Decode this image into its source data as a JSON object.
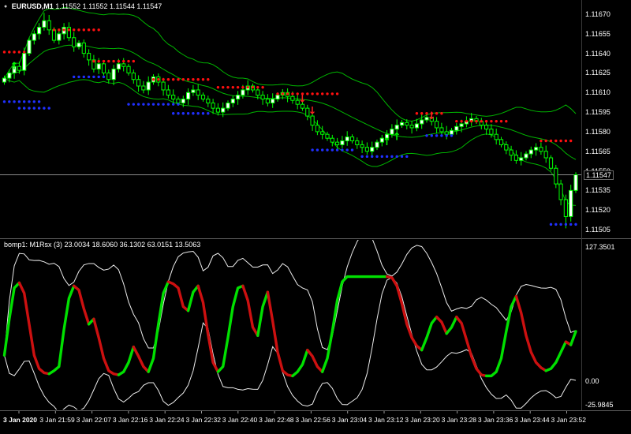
{
  "header": {
    "symbol": "EURUSD,M1",
    "ohlc": "1.11552 1.11552 1.11544 1.11547",
    "marker": "●"
  },
  "indicator_header": {
    "name": "bomp1: M1Rsx (3)",
    "values": "23.0034 18.6060 36.1302 63.0151 13.5063"
  },
  "price_axis": {
    "labels": [
      "1.11670",
      "1.11655",
      "1.11640",
      "1.11625",
      "1.11610",
      "1.11595",
      "1.11580",
      "1.11565",
      "1.11550",
      "1.11535",
      "1.11520",
      "1.11505"
    ],
    "current_price": "1.11547"
  },
  "indicator_axis": {
    "max": "127.3501",
    "zero": "0.00",
    "min": "-25.9845"
  },
  "time_axis": {
    "labels": [
      "3 Jan 2020",
      "3 Jan 21:59",
      "3 Jan 22:07",
      "3 Jan 22:16",
      "3 Jan 22:24",
      "3 Jan 22:32",
      "3 Jan 22:40",
      "3 Jan 22:48",
      "3 Jan 22:56",
      "3 Jan 23:04",
      "3 Jan 23:12",
      "3 Jan 23:20",
      "3 Jan 23:28",
      "3 Jan 23:36",
      "3 Jan 23:44",
      "3 Jan 23:52"
    ]
  },
  "colors": {
    "background": "#000000",
    "axis_text": "#ffffff",
    "separator": "#616161",
    "bid_line": "#8a8a8a",
    "candle_border": "#00ff00",
    "bull_fill": "#ffffff",
    "bear_fill": "#000000",
    "band": "#00b400",
    "sell_dot": "#ff1010",
    "buy_dot": "#2030ff",
    "arrow_up": "#00ff00",
    "arrow_down": "#ff2020",
    "osc_up": "#00e000",
    "osc_down": "#cc1010",
    "osc_band": "#ededed"
  },
  "chart_data": [
    {
      "type": "candlestick",
      "title": "EURUSD M1 price with Bollinger Bands and semafor dots",
      "ylim": [
        1.11495,
        1.1168
      ],
      "bid": 1.11547,
      "bollinger": {
        "period": 20,
        "deviation": 2
      },
      "closes": [
        1.11621,
        1.11625,
        1.1163,
        1.11627,
        1.1164,
        1.1165,
        1.11655,
        1.1166,
        1.11665,
        1.11658,
        1.1165,
        1.11655,
        1.1166,
        1.11652,
        1.11645,
        1.11648,
        1.1164,
        1.11635,
        1.11628,
        1.11632,
        1.11625,
        1.1162,
        1.11628,
        1.11632,
        1.1163,
        1.11625,
        1.1162,
        1.11615,
        1.11612,
        1.11618,
        1.11622,
        1.11618,
        1.11612,
        1.11608,
        1.11605,
        1.11602,
        1.11605,
        1.1161,
        1.11612,
        1.11608,
        1.11605,
        1.11602,
        1.11598,
        1.11595,
        1.11598,
        1.11602,
        1.11605,
        1.11608,
        1.11612,
        1.11615,
        1.11612,
        1.11608,
        1.11605,
        1.11602,
        1.11605,
        1.11608,
        1.1161,
        1.11607,
        1.11604,
        1.11601,
        1.11598,
        1.11592,
        1.11585,
        1.1158,
        1.11578,
        1.11575,
        1.11572,
        1.1157,
        1.11573,
        1.11576,
        1.11573,
        1.1157,
        1.11568,
        1.11565,
        1.11568,
        1.11572,
        1.11575,
        1.11578,
        1.11582,
        1.11585,
        1.11587,
        1.11585,
        1.11583,
        1.11586,
        1.11589,
        1.11591,
        1.11588,
        1.11583,
        1.1158,
        1.11578,
        1.11581,
        1.11584,
        1.11586,
        1.11588,
        1.1159,
        1.11588,
        1.11585,
        1.11582,
        1.11578,
        1.11574,
        1.1157,
        1.11566,
        1.11562,
        1.11558,
        1.1156,
        1.11563,
        1.11566,
        1.11568,
        1.11565,
        1.1156,
        1.11552,
        1.1154,
        1.11528,
        1.11515,
        1.11535,
        1.11547
      ],
      "wick_overrides": {
        "highs": {
          "8": 1.11671
        },
        "lows": {
          "113": 1.11506
        }
      },
      "sell_dots": [
        {
          "from": 0,
          "to": 4,
          "price": 1.11641
        },
        {
          "from": 10,
          "to": 19,
          "price": 1.11658
        },
        {
          "from": 18,
          "to": 26,
          "price": 1.11634
        },
        {
          "from": 30,
          "to": 41,
          "price": 1.1162
        },
        {
          "from": 43,
          "to": 52,
          "price": 1.11614
        },
        {
          "from": 55,
          "to": 67,
          "price": 1.11609
        },
        {
          "from": 83,
          "to": 88,
          "price": 1.11594
        },
        {
          "from": 91,
          "to": 101,
          "price": 1.11588
        },
        {
          "from": 108,
          "to": 114,
          "price": 1.11573
        }
      ],
      "buy_dots": [
        {
          "from": 0,
          "to": 7,
          "price": 1.11603
        },
        {
          "from": 3,
          "to": 9,
          "price": 1.11598
        },
        {
          "from": 14,
          "to": 20,
          "price": 1.11622
        },
        {
          "from": 25,
          "to": 35,
          "price": 1.11601
        },
        {
          "from": 34,
          "to": 41,
          "price": 1.11594
        },
        {
          "from": 62,
          "to": 70,
          "price": 1.11566
        },
        {
          "from": 72,
          "to": 81,
          "price": 1.11561
        },
        {
          "from": 85,
          "to": 90,
          "price": 1.11577
        },
        {
          "from": 110,
          "to": 115,
          "price": 1.11509
        }
      ],
      "arrows": [
        {
          "index": 2,
          "dir": "up",
          "price": 1.1163
        },
        {
          "index": 60,
          "dir": "down",
          "price": 1.11605
        },
        {
          "index": 62,
          "dir": "down",
          "price": 1.11596
        },
        {
          "index": 77,
          "dir": "up",
          "price": 1.11572
        },
        {
          "index": 79,
          "dir": "up",
          "price": 1.11576
        },
        {
          "index": 86,
          "dir": "down",
          "price": 1.11592
        }
      ]
    },
    {
      "type": "line",
      "title": "M1Rsx oscillator with volatility bands",
      "ylim": [
        -25.9845,
        127.3501
      ],
      "bands": {
        "period": 10,
        "deviation": 2
      },
      "values": [
        25,
        60,
        90,
        95,
        85,
        55,
        25,
        12,
        8,
        7,
        10,
        14,
        50,
        80,
        92,
        88,
        70,
        55,
        60,
        42,
        22,
        10,
        7,
        6,
        9,
        18,
        33,
        24,
        14,
        9,
        22,
        55,
        85,
        96,
        94,
        90,
        72,
        68,
        86,
        92,
        76,
        45,
        18,
        9,
        14,
        42,
        72,
        90,
        92,
        78,
        52,
        44,
        72,
        86,
        58,
        28,
        10,
        6,
        5,
        9,
        16,
        30,
        24,
        14,
        9,
        22,
        48,
        78,
        96,
        101,
        101,
        101,
        101,
        101,
        101,
        101,
        101,
        101,
        100,
        92,
        75,
        55,
        42,
        34,
        30,
        42,
        56,
        62,
        57,
        46,
        52,
        62,
        56,
        40,
        24,
        12,
        6,
        5,
        5,
        9,
        22,
        48,
        72,
        82,
        66,
        44,
        28,
        18,
        13,
        10,
        12,
        18,
        28,
        38,
        35,
        48
      ]
    }
  ]
}
